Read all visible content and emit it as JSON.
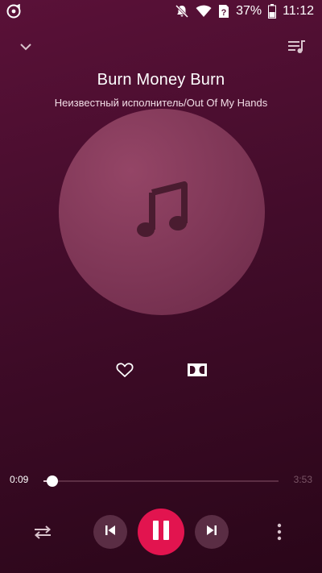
{
  "status_bar": {
    "battery_percent": "37%",
    "time": "11:12",
    "icons": [
      "music-app-notification-icon",
      "mute-icon",
      "wifi-icon",
      "no-sim-icon",
      "battery-icon"
    ]
  },
  "track": {
    "title": "Burn Money Burn",
    "subtitle": "Неизвестный исполнитель/Out Of My Hands"
  },
  "playback": {
    "current_time": "0:09",
    "total_time": "3:53",
    "progress": 0.039,
    "state": "playing"
  },
  "colors": {
    "background": "#420c2a",
    "accent": "#e2144f",
    "art": "#7e3656"
  },
  "icons": {
    "top_left": "chevron-down-icon",
    "top_right": "queue-icon",
    "art": "music-note-icon",
    "favorite": "heart-icon",
    "audio_effect": "dolby-icon",
    "repeat": "repeat-icon",
    "previous": "skip-previous-icon",
    "play_pause": "pause-icon",
    "next": "skip-next-icon",
    "menu": "more-vert-icon"
  }
}
